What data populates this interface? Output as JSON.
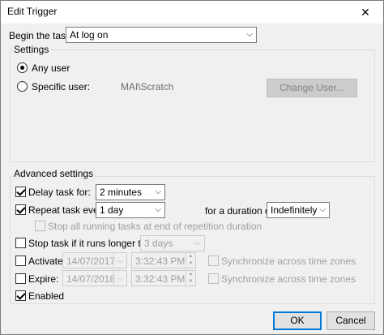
{
  "window": {
    "title": "Edit Trigger",
    "close_glyph": "✕"
  },
  "begin": {
    "label": "Begin the task:",
    "value": "At log on"
  },
  "settings": {
    "title": "Settings",
    "any_user": "Any user",
    "specific_user": "Specific user:",
    "user_value": "MAI\\Scratch",
    "change_user_button": "Change User..."
  },
  "advanced": {
    "title": "Advanced settings",
    "delay_label": "Delay task for:",
    "delay_value": "2 minutes",
    "repeat_label": "Repeat task every:",
    "repeat_value": "1 day",
    "duration_label": "for a duration of:",
    "duration_value": "Indefinitely",
    "stop_all_label": "Stop all running tasks at end of repetition duration",
    "stop_if_label": "Stop task if it runs longer than:",
    "stop_if_value": "3 days",
    "activate_label": "Activate:",
    "activate_date": "14/07/2017",
    "activate_time": "3:32:43 PM",
    "expire_label": "Expire:",
    "expire_date": "14/07/2018",
    "expire_time": "3:32:43 PM",
    "sync_label": "Synchronize across time zones",
    "enabled_label": "Enabled"
  },
  "buttons": {
    "ok": "OK",
    "cancel": "Cancel"
  },
  "icons": {
    "dropdown": "chevron-down-icon",
    "calendar": "calendar-icon",
    "close": "close-icon"
  },
  "colors": {
    "accent": "#0078d7",
    "dialog_bg": "#f0f0f0",
    "disabled_text": "#a0a0a0"
  }
}
